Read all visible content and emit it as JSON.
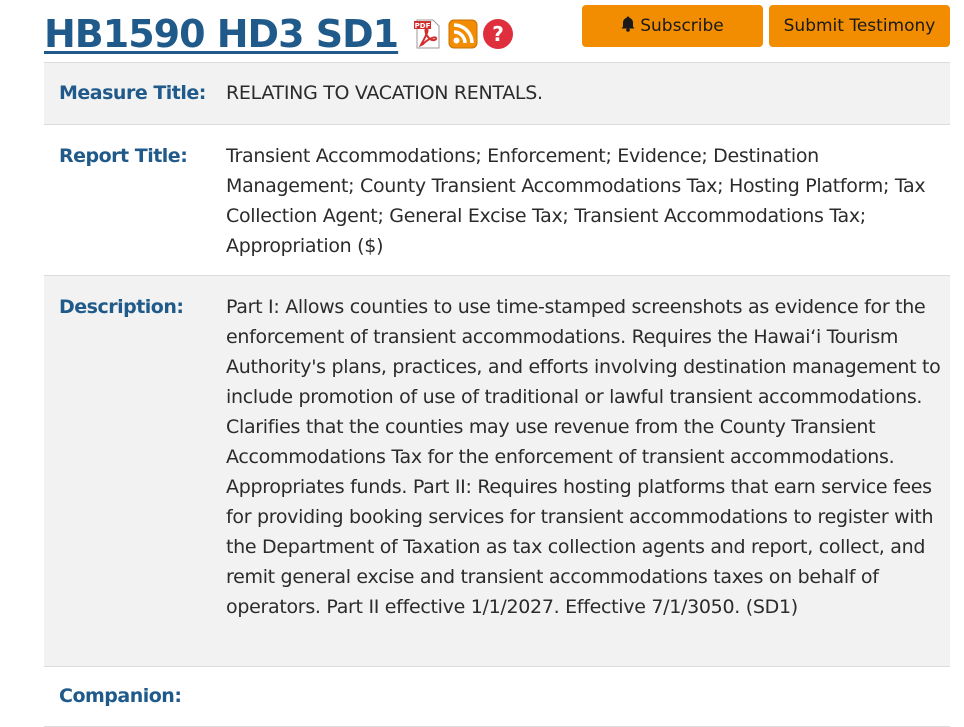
{
  "header": {
    "bill_title": "HB1590 HD3 SD1",
    "icons": [
      "pdf-icon",
      "rss-icon",
      "help-icon"
    ],
    "subscribe_label": "Subscribe",
    "testimony_label": "Submit Testimony"
  },
  "colors": {
    "accent": "#f28c00",
    "label": "#1f5a8a",
    "shade": "#f2f2f2"
  },
  "rows": [
    {
      "label": "Measure Title:",
      "value": "RELATING TO VACATION RENTALS."
    },
    {
      "label": "Report Title:",
      "value": "Transient Accommodations; Enforcement; Evidence; Destination Management; County Transient Accommodations Tax; Hosting Platform; Tax Collection Agent; General Excise Tax; Transient Accommodations Tax; Appropriation ($)"
    },
    {
      "label": "Description:",
      "value": "Part I: Allows counties to use time-stamped screenshots as evidence for the enforcement of transient accommodations. Requires the Hawaiʻi Tourism Authority's plans, practices, and efforts involving destination management to include promotion of use of traditional or lawful transient accommodations. Clarifies that the counties may use revenue from the County Transient Accommodations Tax for the enforcement of transient accommodations. Appropriates funds. Part II: Requires hosting platforms that earn service fees for providing booking services for transient accommodations to register with the Department of Taxation as tax collection agents and report, collect, and remit general excise and transient accommodations taxes on behalf of operators. Part II effective 1/1/2027. Effective 7/1/3050. (SD1)"
    },
    {
      "label": "Companion:",
      "value": ""
    }
  ]
}
